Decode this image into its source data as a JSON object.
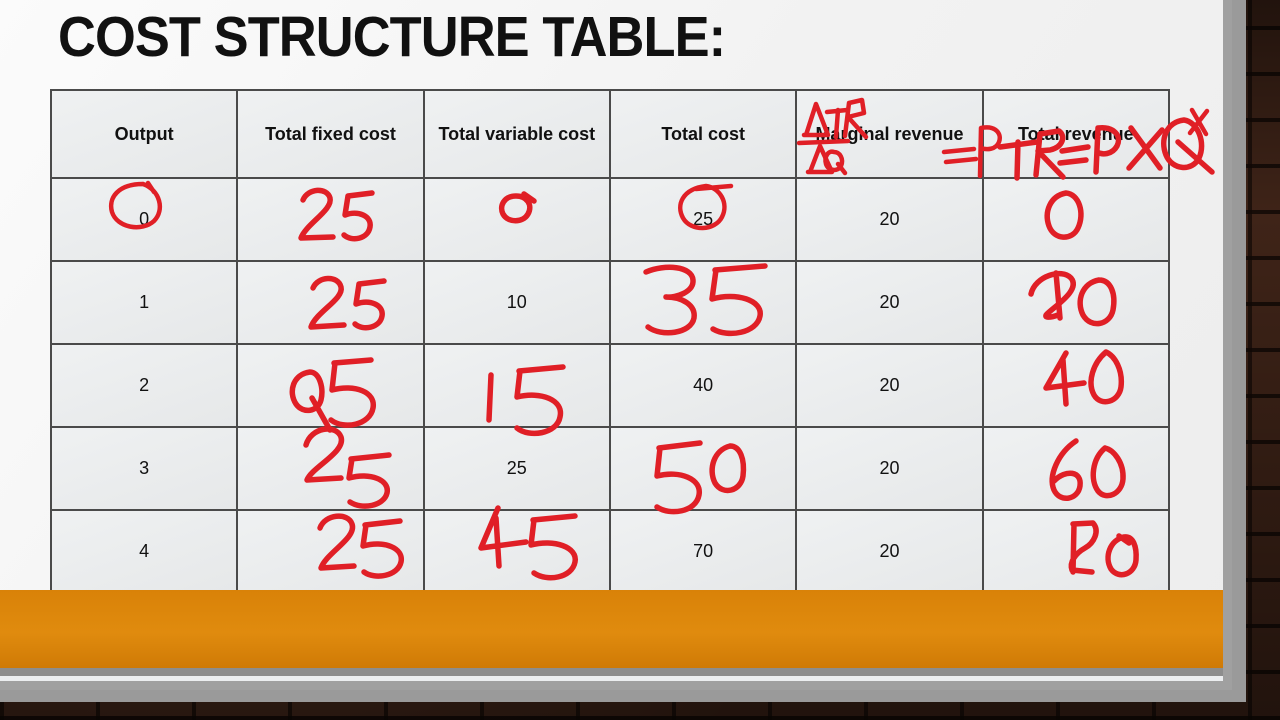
{
  "slide": {
    "title": "COST STRUCTURE TABLE:",
    "accent_orange": "#d98208",
    "ink_color": "#e01f26",
    "background": "brick-wall"
  },
  "table": {
    "headers": [
      "Output",
      "Total fixed cost",
      "Total variable cost",
      "Total cost",
      "Marginal revenue",
      "Total revenue"
    ],
    "rows": [
      {
        "output": "0",
        "total_fixed_cost": "25",
        "total_variable_cost": "0",
        "total_cost": "25",
        "marginal_revenue": "20",
        "total_revenue": "0"
      },
      {
        "output": "1",
        "total_fixed_cost": "25",
        "total_variable_cost": "10",
        "total_cost": "35",
        "marginal_revenue": "20",
        "total_revenue": "20"
      },
      {
        "output": "2",
        "total_fixed_cost": "25",
        "total_variable_cost": "15",
        "total_cost": "40",
        "marginal_revenue": "20",
        "total_revenue": "40"
      },
      {
        "output": "3",
        "total_fixed_cost": "25",
        "total_variable_cost": "25",
        "total_cost": "50",
        "marginal_revenue": "20",
        "total_revenue": "60"
      },
      {
        "output": "4",
        "total_fixed_cost": "25",
        "total_variable_cost": "45",
        "total_cost": "70",
        "marginal_revenue": "20",
        "total_revenue": "80"
      }
    ],
    "printed_cells": [
      [
        "0",
        "",
        "",
        "25",
        "20",
        ""
      ],
      [
        "1",
        "",
        "10",
        "",
        "20",
        ""
      ],
      [
        "2",
        "",
        "",
        "40",
        "20",
        ""
      ],
      [
        "3",
        "",
        "25",
        "",
        "20",
        ""
      ],
      [
        "4",
        "",
        "",
        "70",
        "20",
        ""
      ]
    ],
    "handwritten_cells": [
      [
        "",
        "25",
        "0",
        "",
        "",
        "0"
      ],
      [
        "",
        "25",
        "",
        "35",
        "",
        "20"
      ],
      [
        "",
        "25",
        "15",
        "",
        "",
        "40"
      ],
      [
        "",
        "25",
        "",
        "50",
        "",
        "60"
      ],
      [
        "",
        "25",
        "45",
        "",
        "",
        "80"
      ]
    ]
  },
  "annotations": {
    "marginal_revenue_formula_numerator": "ΔTR",
    "marginal_revenue_formula_denominator": "ΔQ",
    "marginal_revenue_equals": "=P",
    "total_revenue_formula": "TR = P X Q",
    "circled_output": "0",
    "circled_total_cost": "25"
  }
}
